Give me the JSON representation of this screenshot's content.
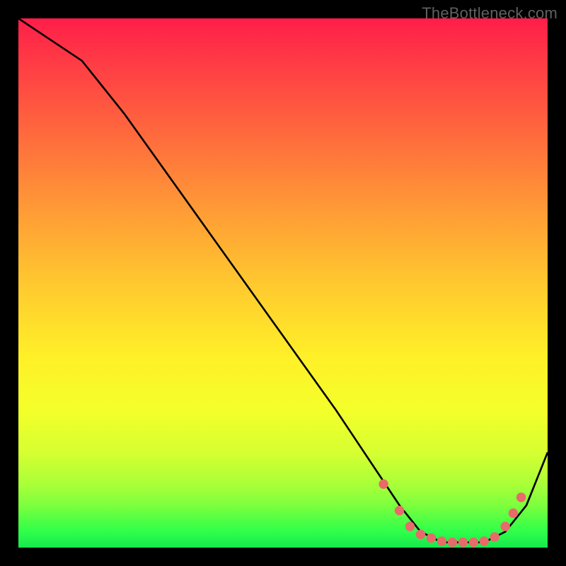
{
  "watermark": "TheBottleneck.com",
  "chart_data": {
    "type": "line",
    "title": "",
    "xlabel": "",
    "ylabel": "",
    "xlim": [
      0,
      100
    ],
    "ylim": [
      0,
      100
    ],
    "grid": false,
    "legend": false,
    "background": "gradient-heatmap",
    "series": [
      {
        "name": "curve",
        "color": "#000000",
        "x": [
          0,
          6,
          12,
          20,
          30,
          40,
          50,
          60,
          68,
          72,
          76,
          80,
          84,
          88,
          92,
          96,
          100
        ],
        "y": [
          100,
          96,
          92,
          82,
          68,
          54,
          40,
          26,
          14,
          8,
          3,
          1,
          1,
          1,
          3,
          8,
          18
        ]
      }
    ],
    "markers": {
      "name": "dot-cluster",
      "color": "#e86a6a",
      "points": [
        {
          "x": 69,
          "y": 12
        },
        {
          "x": 72,
          "y": 7
        },
        {
          "x": 74,
          "y": 4
        },
        {
          "x": 76,
          "y": 2.5
        },
        {
          "x": 78,
          "y": 1.8
        },
        {
          "x": 80,
          "y": 1.2
        },
        {
          "x": 82,
          "y": 1.0
        },
        {
          "x": 84,
          "y": 1.0
        },
        {
          "x": 86,
          "y": 1.0
        },
        {
          "x": 88,
          "y": 1.2
        },
        {
          "x": 90,
          "y": 2.0
        },
        {
          "x": 92,
          "y": 4.0
        },
        {
          "x": 93.5,
          "y": 6.5
        },
        {
          "x": 95,
          "y": 9.5
        }
      ]
    }
  }
}
